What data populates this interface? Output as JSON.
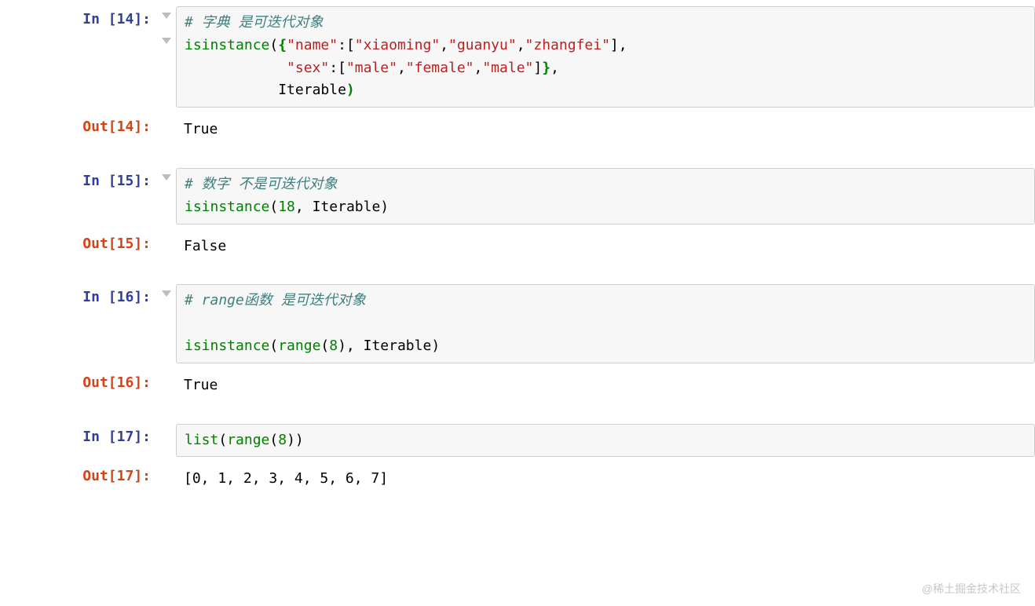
{
  "cells": {
    "c14": {
      "in_prompt": "In [14]:",
      "out_prompt": "Out[14]:",
      "code": {
        "comment": "# 字典 是可迭代对象",
        "func": "isinstance",
        "key1": "\"name\"",
        "vals1": [
          "\"xiaoming\"",
          "\"guanyu\"",
          "\"zhangfei\""
        ],
        "key2": "\"sex\"",
        "vals2": [
          "\"male\"",
          "\"female\"",
          "\"male\""
        ],
        "arg2": "Iterable"
      },
      "output": "True"
    },
    "c15": {
      "in_prompt": "In [15]:",
      "out_prompt": "Out[15]:",
      "code": {
        "comment": "# 数字 不是可迭代对象",
        "func": "isinstance",
        "num": "18",
        "arg2": "Iterable"
      },
      "output": "False"
    },
    "c16": {
      "in_prompt": "In [16]:",
      "out_prompt": "Out[16]:",
      "code": {
        "comment": "# range函数 是可迭代对象",
        "func": "isinstance",
        "range_func": "range",
        "range_num": "8",
        "arg2": "Iterable"
      },
      "output": "True"
    },
    "c17": {
      "in_prompt": "In [17]:",
      "out_prompt": "Out[17]:",
      "code": {
        "func": "list",
        "range_func": "range",
        "range_num": "8"
      },
      "output": "[0, 1, 2, 3, 4, 5, 6, 7]"
    }
  },
  "watermark": "@稀土掘金技术社区"
}
